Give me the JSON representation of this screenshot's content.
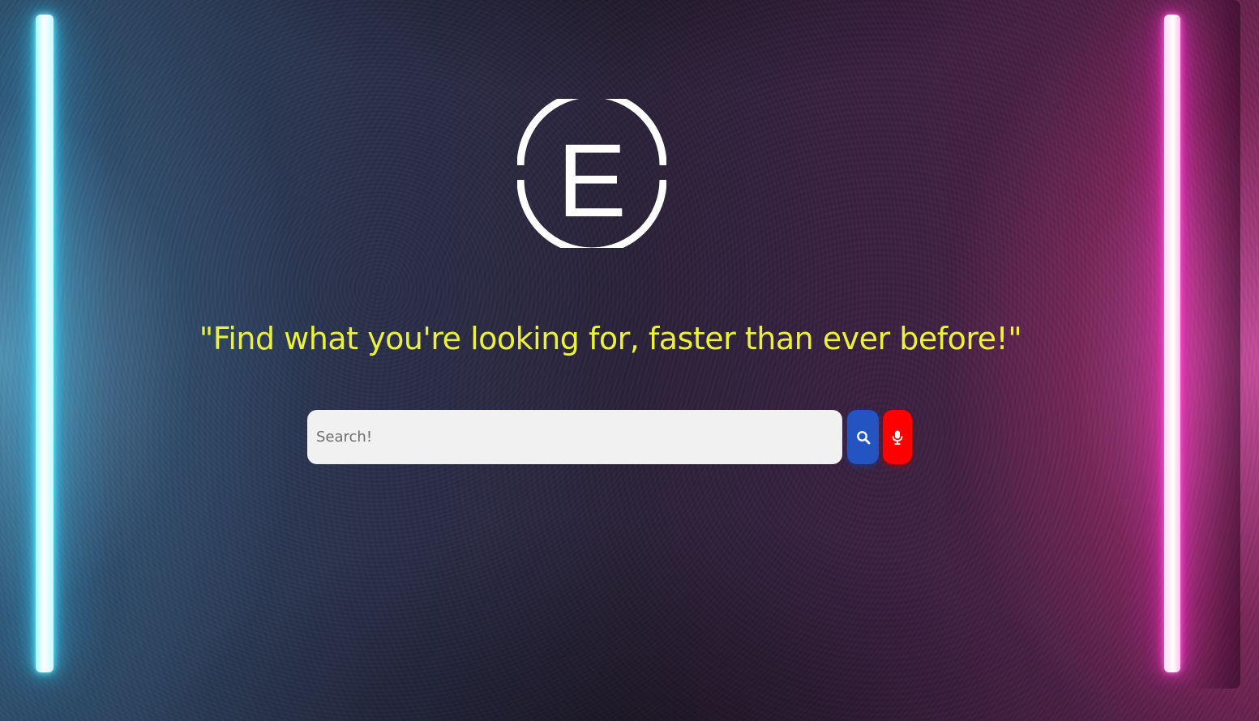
{
  "logo": {
    "letter": "E",
    "icon": "circle-e-logo"
  },
  "tagline": "\"Find what you're looking for, faster than ever before!\"",
  "search": {
    "placeholder": "Search!",
    "value": ""
  },
  "buttons": {
    "search_icon": "magnifier-icon",
    "mic_icon": "microphone-icon"
  },
  "colors": {
    "tagline": "#ecf23a",
    "search_button": "#2454c2",
    "mic_button": "#ff0000",
    "neon_left": "#35d8ff",
    "neon_right": "#ff2fc8"
  }
}
